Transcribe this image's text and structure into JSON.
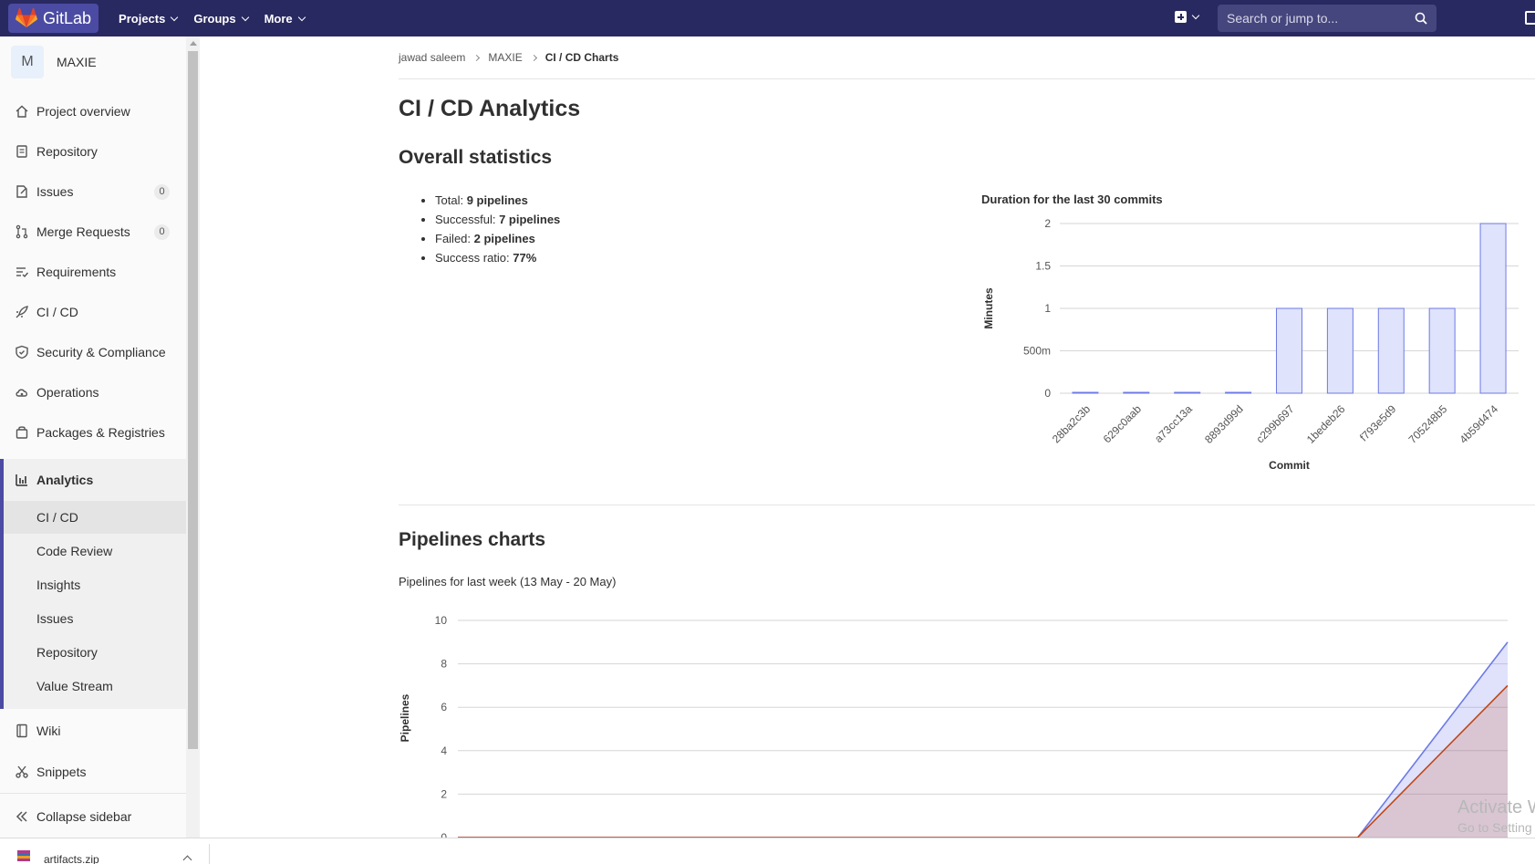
{
  "topbar": {
    "logo_text": "GitLab",
    "nav": [
      "Projects",
      "Groups",
      "More"
    ],
    "search_placeholder": "Search or jump to..."
  },
  "sidebar": {
    "project_initial": "M",
    "project_name": "MAXIE",
    "items": [
      {
        "label": "Project overview",
        "icon": "home-icon"
      },
      {
        "label": "Repository",
        "icon": "doc-icon"
      },
      {
        "label": "Issues",
        "icon": "issues-icon",
        "badge": "0"
      },
      {
        "label": "Merge Requests",
        "icon": "merge-request-icon",
        "badge": "0"
      },
      {
        "label": "Requirements",
        "icon": "requirements-icon"
      },
      {
        "label": "CI / CD",
        "icon": "rocket-icon"
      },
      {
        "label": "Security & Compliance",
        "icon": "shield-icon"
      },
      {
        "label": "Operations",
        "icon": "cloud-gear-icon"
      },
      {
        "label": "Packages & Registries",
        "icon": "package-icon"
      },
      {
        "label": "Analytics",
        "icon": "chart-icon"
      }
    ],
    "analytics_sub": [
      "CI / CD",
      "Code Review",
      "Insights",
      "Issues",
      "Repository",
      "Value Stream"
    ],
    "bottom_items": [
      {
        "label": "Wiki",
        "icon": "book-icon"
      },
      {
        "label": "Snippets",
        "icon": "scissors-icon"
      }
    ],
    "collapse_label": "Collapse sidebar"
  },
  "breadcrumb": [
    "jawad saleem",
    "MAXIE",
    "CI / CD Charts"
  ],
  "page_title": "CI / CD Analytics",
  "overall": {
    "heading": "Overall statistics",
    "stats": [
      {
        "label": "Total: ",
        "value": "9 pipelines"
      },
      {
        "label": "Successful: ",
        "value": "7 pipelines"
      },
      {
        "label": "Failed: ",
        "value": "2 pipelines"
      },
      {
        "label": "Success ratio: ",
        "value": "77%"
      }
    ]
  },
  "pipelines": {
    "heading": "Pipelines charts",
    "week_title": "Pipelines for last week (13 May - 20 May)"
  },
  "download": {
    "filename": "artifacts.zip"
  },
  "watermark": {
    "line1": "Activate W",
    "line2": "Go to Setting"
  },
  "colors": {
    "topbar": "#292961",
    "accent": "#4b4ba3",
    "bar_fill": "#dfe3fb",
    "bar_stroke": "#6d7ae6",
    "line_all": "#6d7ae6",
    "line_success": "#c0461a"
  },
  "chart_data": [
    {
      "type": "bar",
      "title": "Duration for the last 30 commits",
      "xlabel": "Commit",
      "ylabel": "Minutes",
      "categories": [
        "28ba2c3b",
        "629c0aab",
        "a73cc13a",
        "8893d99d",
        "c299b697",
        "1bedeb26",
        "f793e5d9",
        "705248b5",
        "4b59d474"
      ],
      "values": [
        0,
        0,
        0,
        0,
        1,
        1,
        1,
        1,
        2
      ],
      "yticks": [
        "0",
        "500m",
        "1",
        "1.5",
        "2"
      ],
      "ylim": [
        0,
        2
      ],
      "grid": true
    },
    {
      "type": "area",
      "title": "Pipelines for last week (13 May - 20 May)",
      "ylabel": "Pipelines",
      "ylim": [
        0,
        10
      ],
      "yticks": [
        "0",
        "2",
        "4",
        "6",
        "8",
        "10"
      ],
      "series": [
        {
          "values": [
            0,
            0,
            0,
            0,
            0,
            0,
            0,
            9
          ]
        },
        {
          "values": [
            0,
            0,
            0,
            0,
            0,
            0,
            0,
            7
          ]
        }
      ],
      "grid": true
    }
  ]
}
